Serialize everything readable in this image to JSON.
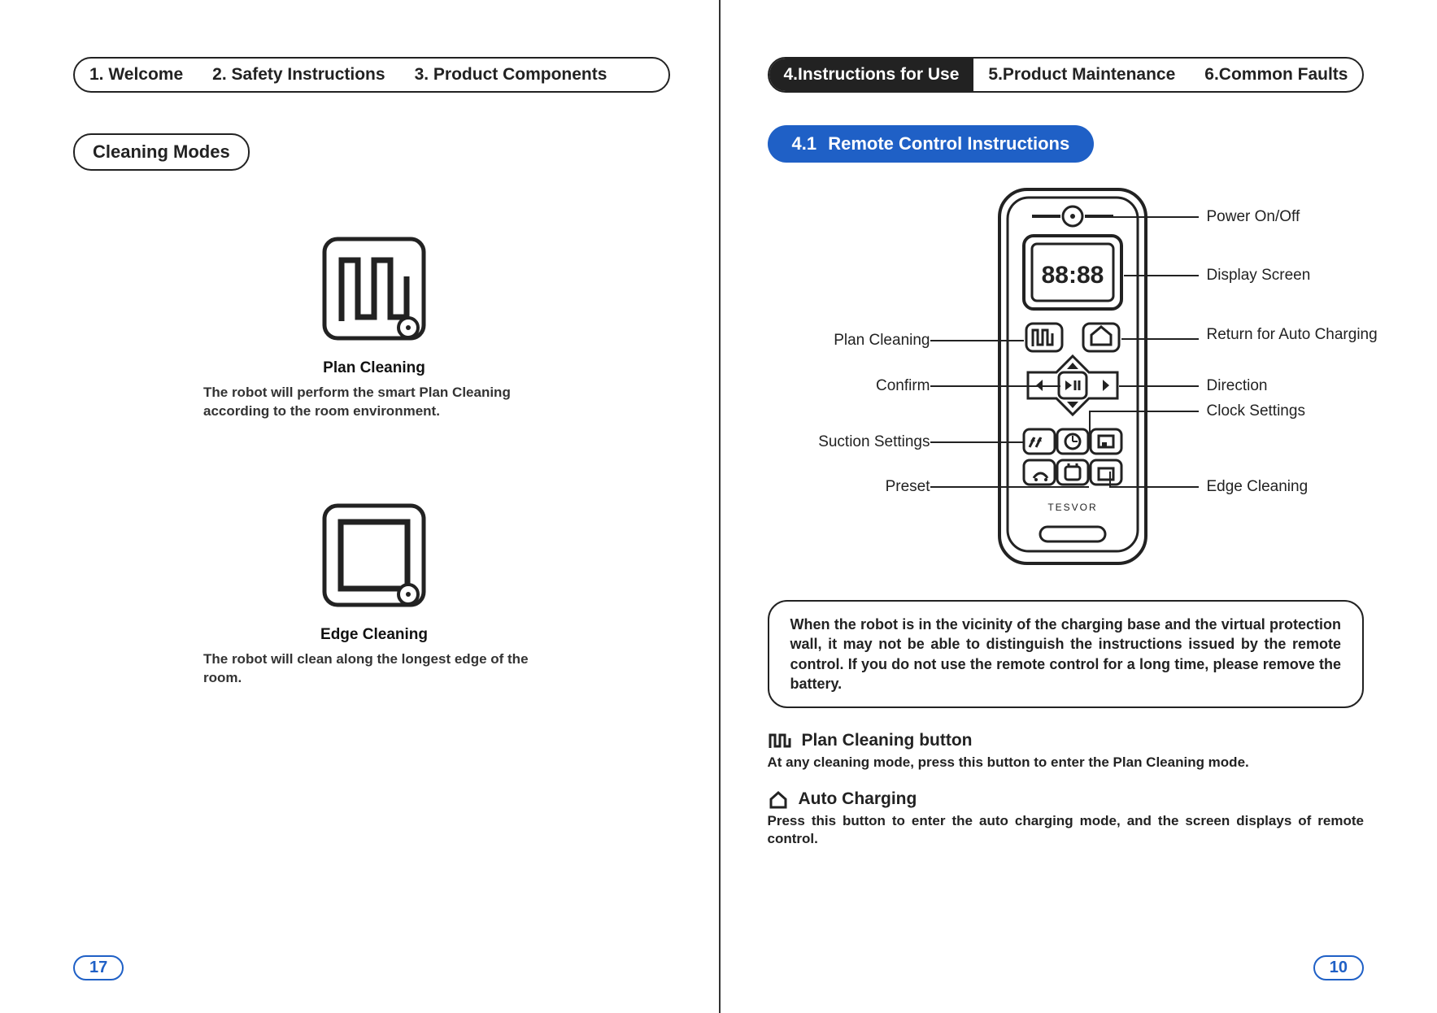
{
  "left": {
    "tabs": [
      "1. Welcome",
      "2. Safety Instructions",
      "3. Product Components"
    ],
    "section": "Cleaning Modes",
    "modes": [
      {
        "title": "Plan Cleaning",
        "desc": "The robot will perform the smart Plan Cleaning according to the room environment."
      },
      {
        "title": "Edge Cleaning",
        "desc": "The robot will clean along the longest edge of the room."
      }
    ],
    "pagenum": "17"
  },
  "right": {
    "tabs": [
      "4.Instructions for Use",
      "5.Product Maintenance",
      "6.Common Faults"
    ],
    "active_tab": 0,
    "section_num": "4.1",
    "section_title": "Remote Control Instructions",
    "callouts": {
      "power": "Power On/Off",
      "display": "Display Screen",
      "plan": "Plan Cleaning",
      "return": "Return for Auto Charging",
      "confirm": "Confirm",
      "direction": "Direction",
      "clock": "Clock Settings",
      "suction": "Suction Settings",
      "preset": "Preset",
      "edge": "Edge Cleaning"
    },
    "remote_display": "88:88",
    "remote_brand": "TESVOR",
    "note": "When the robot is in the vicinity of the charging base and the virtual protection wall, it may not be able to distinguish the instructions issued by the remote control. If you do not use the remote control for a long time, please remove the battery.",
    "explanations": [
      {
        "icon": "plan",
        "title": "Plan Cleaning button",
        "desc": "At any cleaning mode, press this button to enter the Plan Cleaning mode."
      },
      {
        "icon": "home",
        "title": "Auto Charging",
        "desc": "Press this button to enter the auto charging mode, and the screen displays of remote control."
      }
    ],
    "pagenum": "10"
  }
}
